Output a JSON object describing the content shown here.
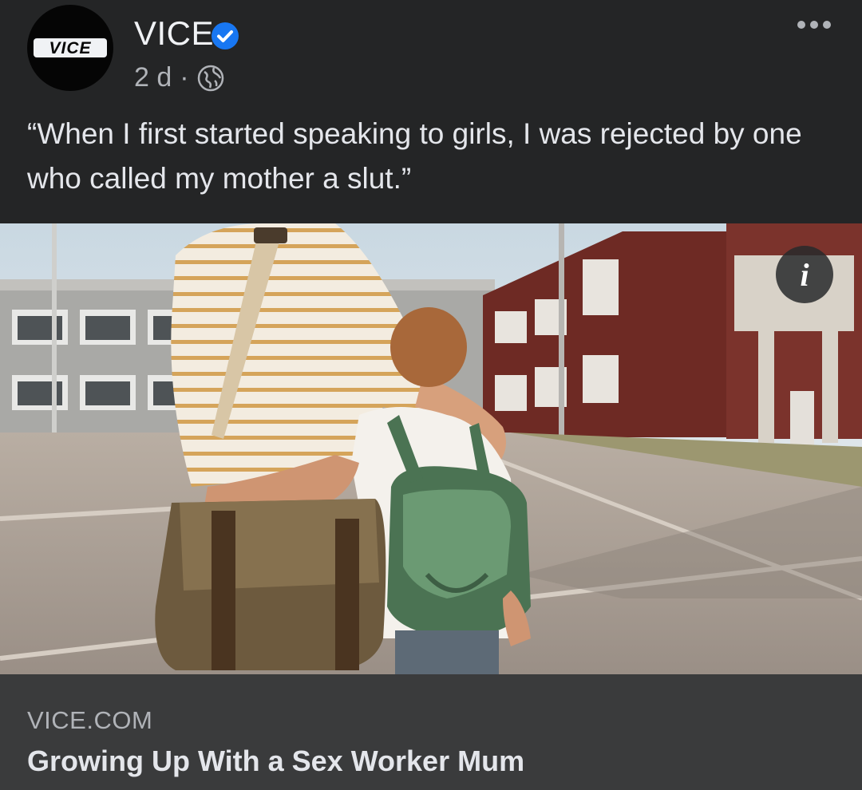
{
  "post": {
    "author": {
      "name": "VICE",
      "avatar_text": "VICE",
      "verified": true,
      "verified_color": "#1877f2"
    },
    "meta": {
      "time": "2 d",
      "separator": "·",
      "audience_icon": "globe-icon"
    },
    "more_icon": "more-horizontal-icon",
    "caption": "“When I first started speaking to girls, I was rejected by one who called my mother a slut.”",
    "image": {
      "description_icon": "info-icon",
      "info_glyph": "i"
    },
    "link_preview": {
      "domain": "VICE.COM",
      "title": "Growing Up With a Sex Worker Mum"
    }
  },
  "colors": {
    "background": "#242526",
    "link_preview_bg": "#3a3b3c",
    "primary_text": "#e4e6eb",
    "secondary_text": "#b0b3b8"
  }
}
